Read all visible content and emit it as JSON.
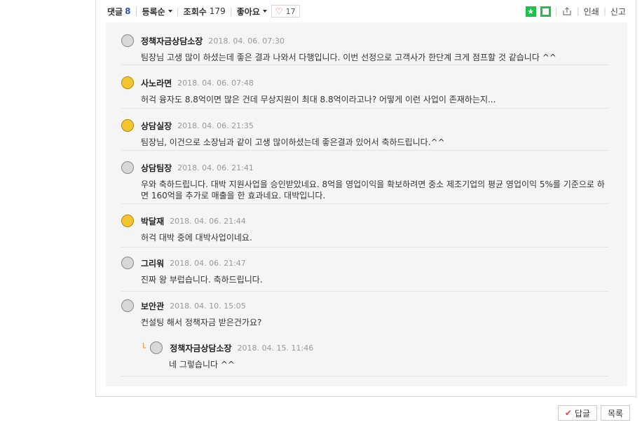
{
  "topbar": {
    "comments_label": "댓글",
    "comments_count": "8",
    "sort_label": "등록순",
    "views_label": "조회수",
    "views_value": "179",
    "likes_label": "좋아요",
    "like_count": "17",
    "print_label": "인쇄",
    "report_label": "신고"
  },
  "comments": [
    {
      "author": "정책자금상담소장",
      "date": "2018. 04. 06.  07:30",
      "text": "팀장님 고생 많이 하셨는데 좋은 결과 나와서 다행입니다. 이번 선정으로 고객사가 한단계 크게 점프할 것 같습니다 ^^",
      "avatar": "gray"
    },
    {
      "author": "사노라면",
      "date": "2018. 04. 06.  07:48",
      "text": "허걱 융자도 8.8억이면 많은 건데 무상지원이 최대 8.8억이라고나? 어떻게 이런 사업이 존재하는지...",
      "avatar": "yellow"
    },
    {
      "author": "상담실장",
      "date": "2018. 04. 06.  21:35",
      "text": "팀장님, 이건으로 소장님과 같이 고생 많이하셨는데 좋은결과 있어서 축하드립니다.^^",
      "avatar": "yellow"
    },
    {
      "author": "상담팀장",
      "date": "2018. 04. 06.  21:41",
      "text": "우와 축하드립니다. 대박 지원사업을 승인받았네요. 8억을 영업이익을 확보하려면 중소 제조기업의 평균 영업이익 5%를 기준으로 하면 160억을 추가로 매출을 한 효과네요. 대박입니다.",
      "avatar": "gray"
    },
    {
      "author": "박달재",
      "date": "2018. 04. 06.  21:44",
      "text": "허걱 대박 중에 대박사업이네요.",
      "avatar": "yellow"
    },
    {
      "author": "그리워",
      "date": "2018. 04. 06.  21:47",
      "text": "진짜 왕 부럽습니다. 축하드립니다.",
      "avatar": "gray"
    },
    {
      "author": "보안관",
      "date": "2018. 04. 10.  15:05",
      "text": "컨설팅 해서 정책자금 받은건가요?",
      "avatar": "gray"
    }
  ],
  "reply": {
    "author": "정책자금상담소장",
    "date": "2018. 04. 15.  11:46",
    "text": "네 그렇습니다 ^^",
    "avatar": "gray",
    "mark": "└"
  },
  "buttons": {
    "reply_label": "답글",
    "list_label": "목록"
  },
  "colors": {
    "accent_green": "#1fc14a",
    "heart_red": "#e24b4b",
    "count_blue": "#2f55b5"
  }
}
